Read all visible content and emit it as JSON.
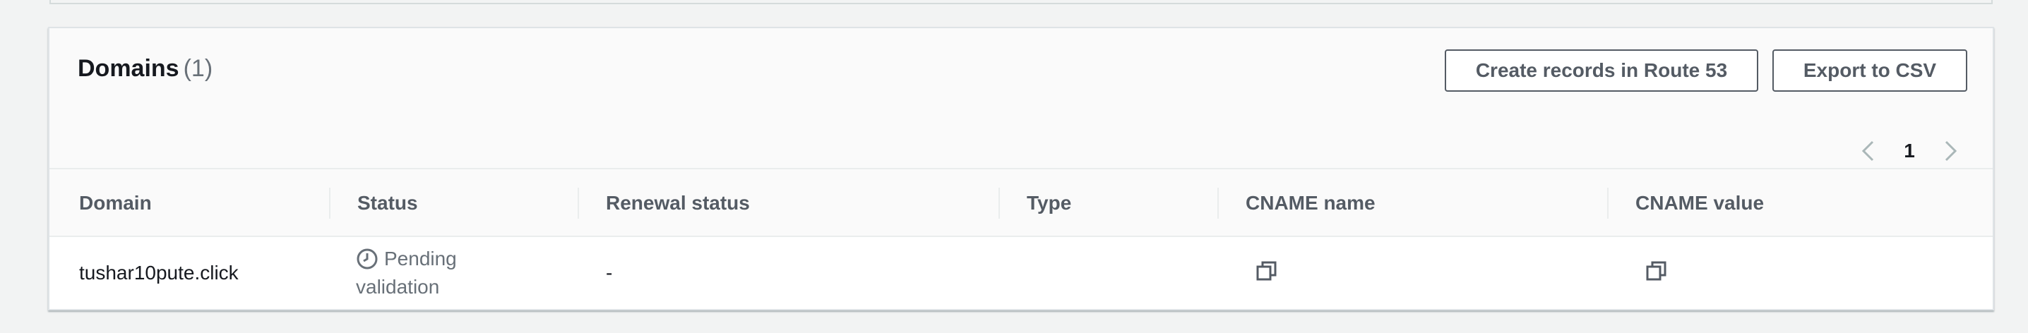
{
  "domains_panel": {
    "title": "Domains",
    "count": "(1)",
    "buttons": {
      "create_records": "Create records in Route 53",
      "export_csv": "Export to CSV"
    },
    "pagination": {
      "current_page": "1"
    },
    "columns": [
      "Domain",
      "Status",
      "Renewal status",
      "Type",
      "CNAME name",
      "CNAME value"
    ],
    "rows": [
      {
        "domain": "tushar10pute.click",
        "status_line1": "Pending",
        "status_line2": "validation",
        "status_icon": "clock-icon",
        "renewal_status": "-",
        "type": "",
        "cname_name_icon": "copy-icon",
        "cname_value_icon": "copy-icon"
      }
    ]
  },
  "colors": {
    "button_border": "#545b64",
    "header_text": "#545b64",
    "status_pending": "#687078"
  }
}
